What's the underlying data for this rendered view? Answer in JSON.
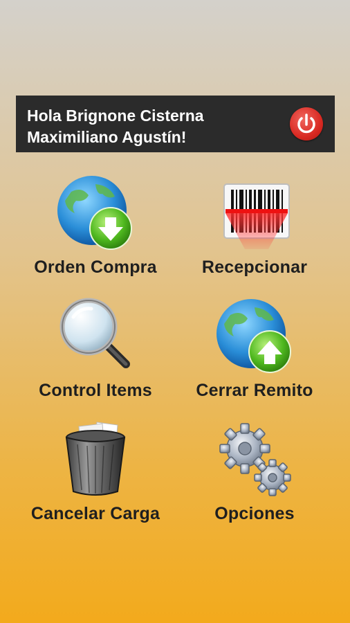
{
  "header": {
    "greeting_line1": "Hola Brignone Cisterna",
    "greeting_line2": "Maximiliano Agustín!",
    "logout_icon": "power-icon",
    "accent_color": "#d92a23"
  },
  "menu": {
    "orden_compra": {
      "label": "Orden Compra",
      "icon": "globe-download-icon"
    },
    "recepcionar": {
      "label": "Recepcionar",
      "icon": "barcode-scanner-icon"
    },
    "control_items": {
      "label": "Control Items",
      "icon": "magnifier-icon"
    },
    "cerrar_remito": {
      "label": "Cerrar Remito",
      "icon": "globe-upload-icon"
    },
    "cancelar_carga": {
      "label": "Cancelar Carga",
      "icon": "trash-icon"
    },
    "opciones": {
      "label": "Opciones",
      "icon": "gears-icon"
    }
  }
}
